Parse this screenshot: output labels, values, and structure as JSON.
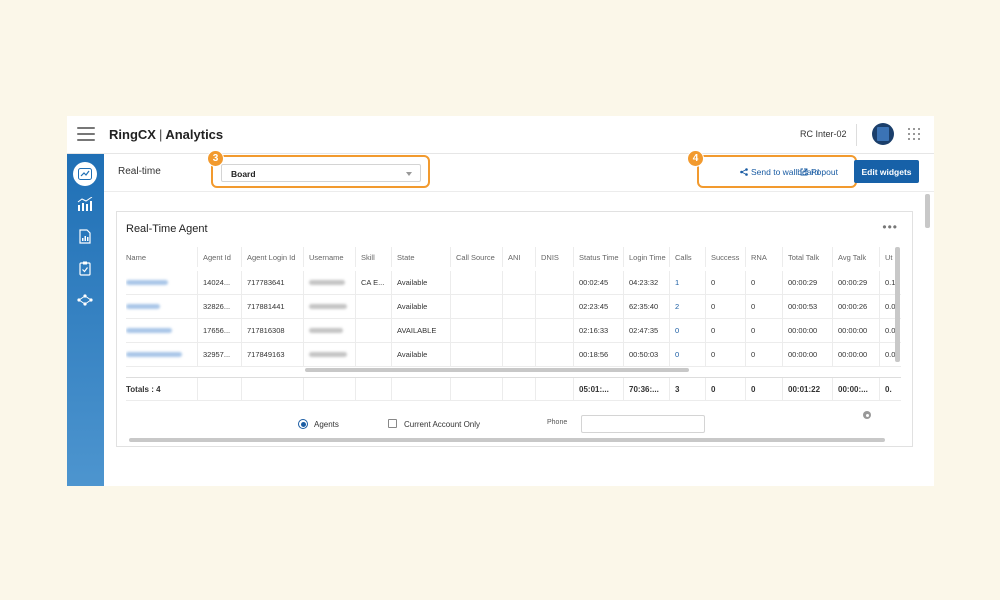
{
  "app": {
    "brand": "RingCX",
    "section": "Analytics",
    "account": "RC Inter-02"
  },
  "subbar": {
    "realtime_label": "Real-time",
    "board_value": "Board",
    "send_wallboard": "Send to wallboard",
    "popout": "Popout",
    "edit_widgets": "Edit widgets",
    "callout_3": "3",
    "callout_4": "4"
  },
  "sidebar": {
    "items": [
      {
        "icon": "realtime-chart-icon",
        "active": true
      },
      {
        "icon": "analytics-icon",
        "active": false
      },
      {
        "icon": "report-document-icon",
        "active": false
      },
      {
        "icon": "clipboard-check-icon",
        "active": false
      },
      {
        "icon": "flow-icon",
        "active": false
      }
    ]
  },
  "widget": {
    "title": "Real-Time Agent",
    "menu": "•••",
    "columns": [
      "Name",
      "Agent Id",
      "Agent Login Id",
      "Username",
      "Skill",
      "State",
      "Call Source",
      "ANI",
      "DNIS",
      "Status Time",
      "Login Time",
      "Calls",
      "Success",
      "RNA",
      "Total Talk",
      "Avg Talk",
      "Ut"
    ],
    "rows": [
      {
        "agent_id": "14024...",
        "login_id": "717783641",
        "skill": "CA E...",
        "state": "Available",
        "status_time": "00:02:45",
        "login_time": "04:23:32",
        "calls": "1",
        "success": "0",
        "rna": "0",
        "total_talk": "00:00:29",
        "avg_talk": "00:00:29",
        "ut": "0.1"
      },
      {
        "agent_id": "32826...",
        "login_id": "717881441",
        "skill": "",
        "state": "Available",
        "status_time": "02:23:45",
        "login_time": "62:35:40",
        "calls": "2",
        "success": "0",
        "rna": "0",
        "total_talk": "00:00:53",
        "avg_talk": "00:00:26",
        "ut": "0.0"
      },
      {
        "agent_id": "17656...",
        "login_id": "717816308",
        "skill": "",
        "state": "AVAILABLE",
        "status_time": "02:16:33",
        "login_time": "02:47:35",
        "calls": "0",
        "success": "0",
        "rna": "0",
        "total_talk": "00:00:00",
        "avg_talk": "00:00:00",
        "ut": "0.0"
      },
      {
        "agent_id": "32957...",
        "login_id": "717849163",
        "skill": "",
        "state": "Available",
        "status_time": "00:18:56",
        "login_time": "00:50:03",
        "calls": "0",
        "success": "0",
        "rna": "0",
        "total_talk": "00:00:00",
        "avg_talk": "00:00:00",
        "ut": "0.0"
      }
    ],
    "totals": {
      "label": "Totals : 4",
      "status_time": "05:01:...",
      "login_time": "70:36:...",
      "calls": "3",
      "success": "0",
      "rna": "0",
      "total_talk": "00:01:22",
      "avg_talk": "00:00:...",
      "ut": "0."
    },
    "filters": {
      "agents_label": "Agents",
      "current_account_label": "Current Account Only",
      "phone_label": "Phone",
      "phone_value": ""
    }
  },
  "colors": {
    "accent": "#1761a8",
    "callout": "#f29a2e",
    "sidebar_top": "#1f6fb5",
    "sidebar_bottom": "#4d95cf",
    "background": "#fbf7e9"
  }
}
